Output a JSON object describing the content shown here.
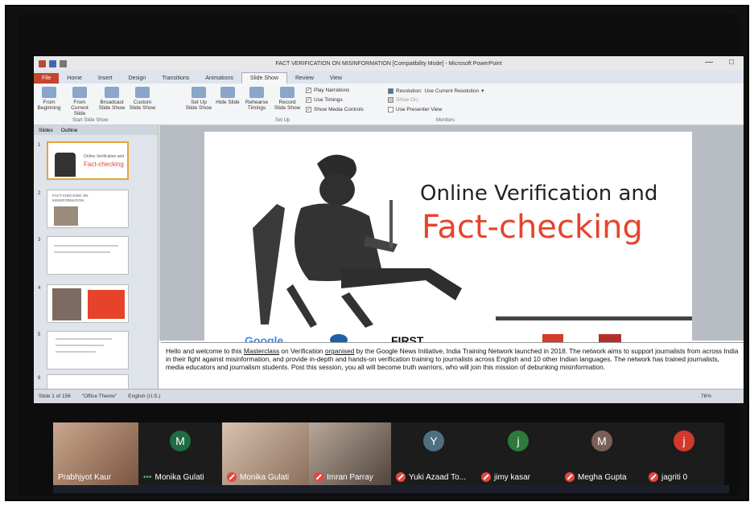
{
  "window": {
    "title": "FACT VERIFICATION ON MISINFORMATION [Compatibility Mode] - Microsoft PowerPoint",
    "min_label": "—",
    "max_label": "□"
  },
  "tabs": [
    "File",
    "Home",
    "Insert",
    "Design",
    "Transitions",
    "Animations",
    "Slide Show",
    "Review",
    "View"
  ],
  "ribbon": {
    "from_beginning": "From Beginning",
    "from_current": "From Current Slide",
    "broadcast": "Broadcast Slide Show",
    "custom": "Custom Slide Show",
    "group_start": "Start Slide Show",
    "setup": "Set Up Slide Show",
    "hide": "Hide Slide",
    "rehearse": "Rehearse Timings",
    "record": "Record Slide Show",
    "play_narrations": "Play Narrations",
    "use_timings": "Use Timings",
    "show_media_controls": "Show Media Controls",
    "group_setup": "Set Up",
    "resolution_label": "Resolution:",
    "resolution_value": "Use Current Resolution",
    "show_on": "Show On:",
    "use_presenter_view": "Use Presenter View",
    "group_monitors": "Monitors"
  },
  "thumbs_tabs": [
    "Slides",
    "Outline"
  ],
  "thumbs": [
    {
      "num": "1",
      "line1": "Online Verification and",
      "line2": "Fact-checking"
    },
    {
      "num": "2",
      "line1": "FACT-CHECKING ON",
      "line2": "MISINFORMATION"
    },
    {
      "num": "3",
      "line1": "",
      "line2": ""
    },
    {
      "num": "4",
      "line1": "",
      "line2": ""
    },
    {
      "num": "5",
      "line1": "",
      "line2": ""
    },
    {
      "num": "6",
      "line1": "",
      "line2": ""
    }
  ],
  "slide": {
    "title_line1": "Online Verification and",
    "title_line2": "Fact-checking",
    "logo_google": "Google",
    "logo_first": "FIRST"
  },
  "notes": {
    "text_before": "Hello and welcome to this ",
    "masterclass": "Masterclass",
    "text_mid1": " on Verification ",
    "organised": "organised",
    "text_after": " by the Google News Initiative, India Training Network launched in 2018. The network aims to support journalists from across India in their fight against misinformation, and provide in-depth and hands-on verification training to journalists across English and 10 other Indian languages. The network has trained journalists, media educators and journalism students.  Post this session, you all will become truth warriors, who will join this mission of debunking misinformation."
  },
  "status": {
    "slide_count": "Slide 1 of 156",
    "theme": "\"Office Theme\"",
    "language": "English (U.S.)",
    "zoom": "76%"
  },
  "participants": [
    {
      "name": "Prabhjyot Kaur",
      "muted": false,
      "kind": "photo",
      "color": "#7a5540"
    },
    {
      "name": "Monika Gulati",
      "muted": false,
      "kind": "avatar",
      "initial": "M",
      "color": "#1f6b43"
    },
    {
      "name": "Monika Gulati",
      "muted": true,
      "kind": "photo",
      "color": "#8a6f5c"
    },
    {
      "name": "Imran Parray",
      "muted": true,
      "kind": "photo",
      "color": "#50443c"
    },
    {
      "name": "Yuki Azaad To...",
      "muted": true,
      "kind": "avatar",
      "initial": "Y",
      "color": "#4e6f82"
    },
    {
      "name": "jimy kasar",
      "muted": true,
      "kind": "avatar",
      "initial": "j",
      "color": "#2d7a3a"
    },
    {
      "name": "Megha Gupta",
      "muted": true,
      "kind": "avatar",
      "initial": "M",
      "color": "#7a5f55"
    },
    {
      "name": "jagriti 0",
      "muted": true,
      "kind": "avatar",
      "initial": "j",
      "color": "#d2392e"
    }
  ]
}
